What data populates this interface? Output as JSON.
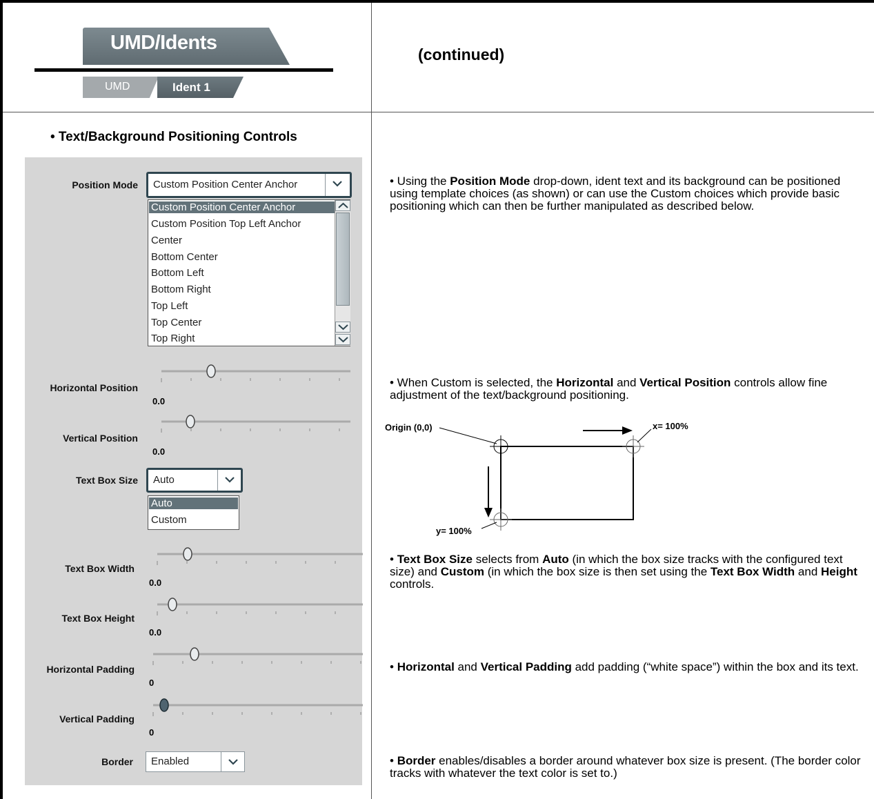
{
  "header": {
    "main_tab": "UMD/Idents",
    "subtabs": [
      "UMD",
      "Ident 1"
    ],
    "continued": "(continued)"
  },
  "section_title": "• Text/Background Positioning Controls",
  "controls": {
    "position_mode": {
      "label": "Position Mode",
      "value": "Custom Position Center Anchor",
      "options": [
        "Custom Position Center Anchor",
        "Custom Position Top Left Anchor",
        "Center",
        "Bottom Center",
        "Bottom Left",
        "Bottom Right",
        "Top Left",
        "Top Center",
        "Top Right"
      ]
    },
    "horizontal_position": {
      "label": "Horizontal Position",
      "value": "0.0"
    },
    "vertical_position": {
      "label": "Vertical Position",
      "value": "0.0"
    },
    "text_box_size": {
      "label": "Text Box Size",
      "value": "Auto",
      "options": [
        "Auto",
        "Custom"
      ]
    },
    "text_box_width": {
      "label": "Text Box Width",
      "value": "0.0"
    },
    "text_box_height": {
      "label": "Text Box Height",
      "value": "0.0"
    },
    "horizontal_padding": {
      "label": "Horizontal Padding",
      "value": "0"
    },
    "vertical_padding": {
      "label": "Vertical Padding",
      "value": "0"
    },
    "border": {
      "label": "Border",
      "value": "Enabled"
    }
  },
  "descriptions": {
    "position_mode": [
      "• Using the ",
      "Position Mode",
      " drop-down, ident text and its background can be positioned using template choices (as shown) or can use the Custom choices which provide basic positioning which can then be further manipulated as described below."
    ],
    "position": [
      "• When Custom is selected, the ",
      "Horizontal",
      " and ",
      "Vertical Position",
      " controls allow fine adjustment of the text/background positioning."
    ],
    "text_box": [
      "• ",
      "Text Box Size",
      " selects from ",
      "Auto",
      " (in which the box size tracks with the configured text size) and ",
      "Custom",
      " (in which the box size is then set using the ",
      "Text Box Width",
      " and ",
      "Height",
      " controls."
    ],
    "padding": [
      "• ",
      "Horizontal",
      " and ",
      "Vertical Padding",
      " add padding (“white space”) within the box and its text."
    ],
    "border": [
      "• ",
      "Border",
      " enables/disables a border around whatever box size is present. (The border color tracks with whatever the text color is set to.)"
    ]
  },
  "diagram": {
    "origin_label": "Origin (0,0)",
    "x_label": "x= 100%",
    "y_label": "y= 100%"
  }
}
